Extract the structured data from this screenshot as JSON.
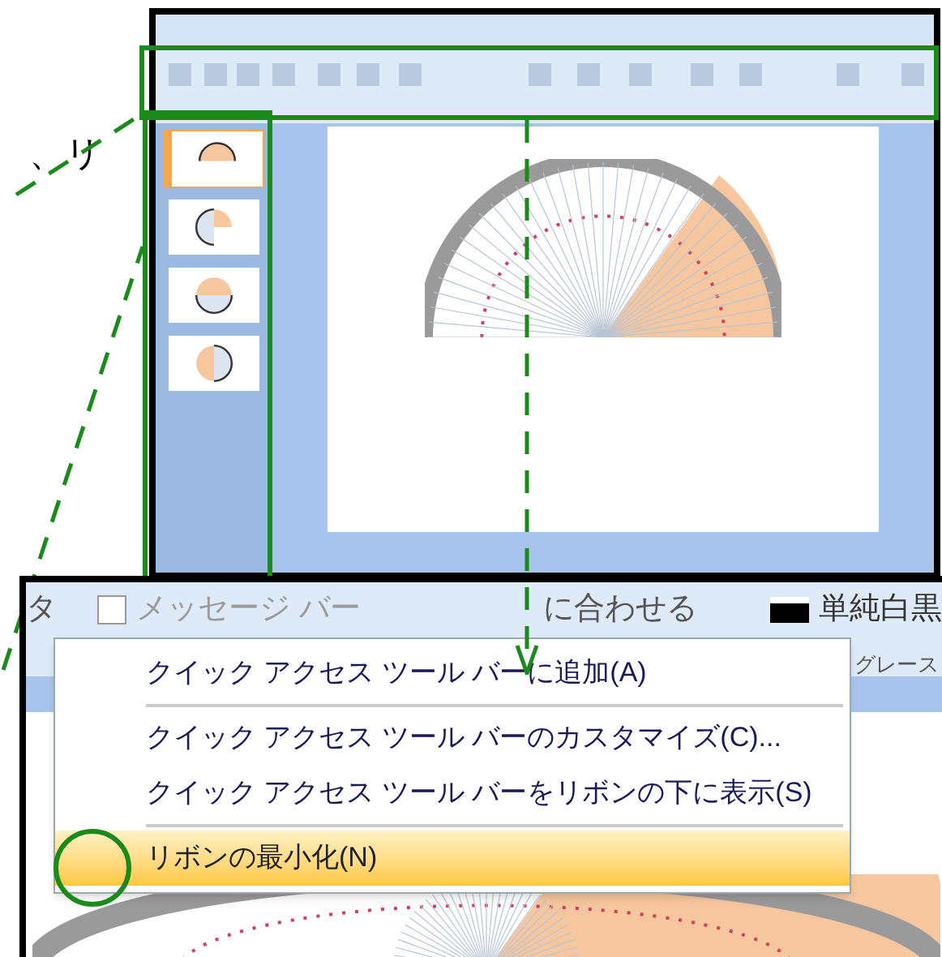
{
  "caption_fragment": "、リ",
  "slides": [
    {
      "selected": true
    },
    {
      "selected": false
    },
    {
      "selected": false
    },
    {
      "selected": false
    }
  ],
  "zoom_ribbon": [
    {
      "kind": "label",
      "text": "タ"
    },
    {
      "kind": "checkbox",
      "text": "メッセージ バー",
      "checked": false
    },
    {
      "kind": "label",
      "text": "に合わせる"
    },
    {
      "kind": "swatch",
      "text": "単純白黒"
    },
    {
      "kind": "label",
      "text": "グレース"
    }
  ],
  "context_menu": [
    {
      "label": "クイック アクセス ツール バーに追加(A)",
      "selected": false,
      "separator_after": true
    },
    {
      "label": "クイック アクセス ツール バーのカスタマイズ(C)...",
      "selected": false,
      "separator_after": false
    },
    {
      "label": "クイック アクセス ツール バーをリボンの下に表示(S)",
      "selected": false,
      "separator_after": true
    },
    {
      "label": "リボンの最小化(N)",
      "selected": true,
      "separator_after": false
    }
  ]
}
